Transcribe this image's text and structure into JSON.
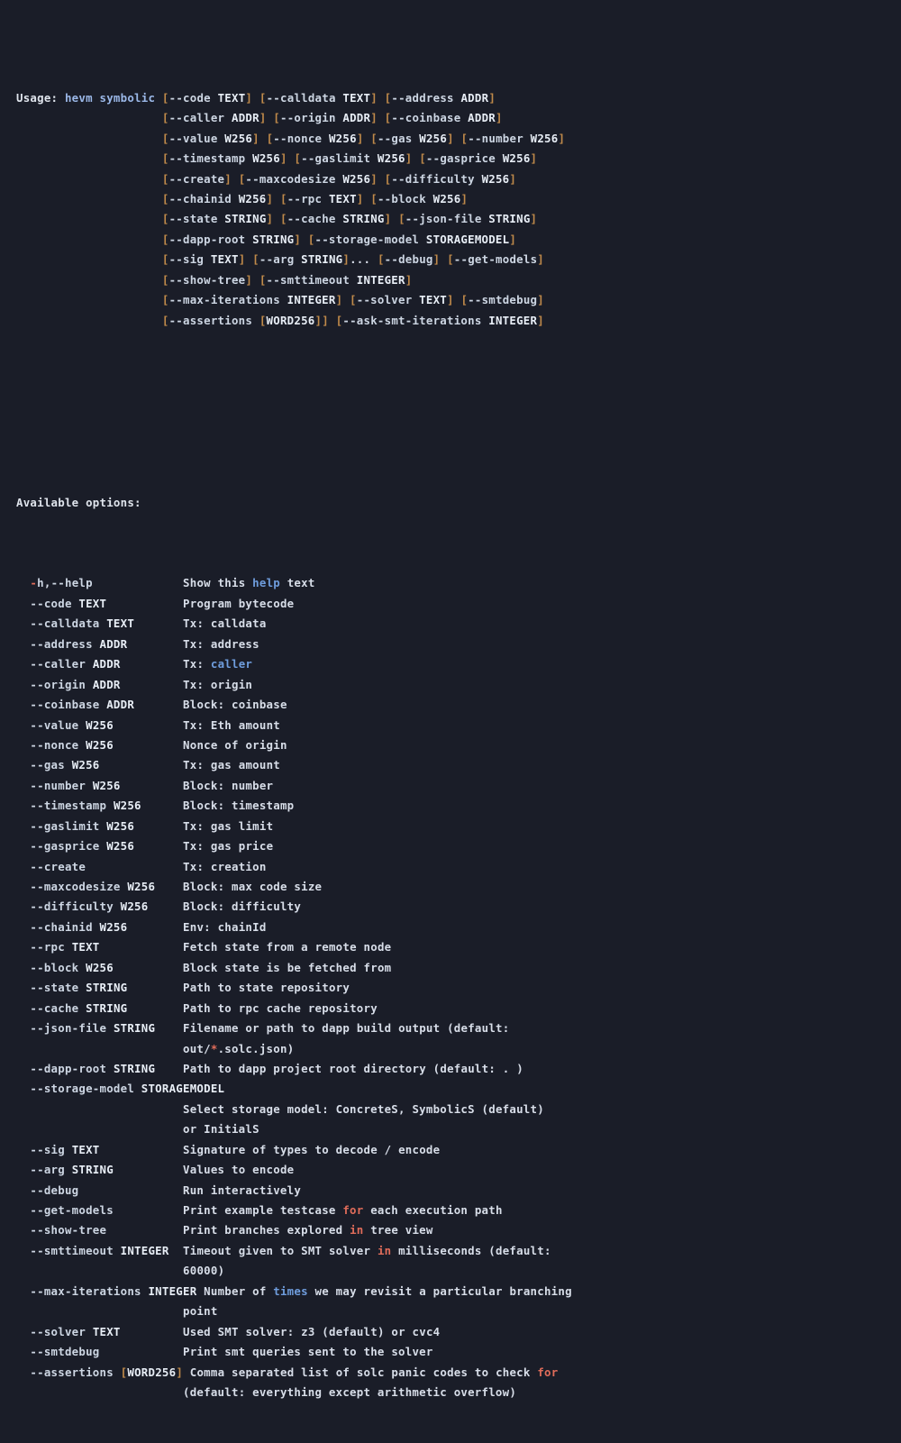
{
  "terminal": {
    "background_color": "#1a1d28",
    "foreground_color": "#d8dee9",
    "accent_bracket_color": "#c08a4a",
    "keyword_color": "#e06c5a",
    "identifier_color": "#6f9ddd",
    "command_color": "#9bb8e8"
  },
  "usage": {
    "label": "Usage:",
    "command": "hevm symbolic",
    "lines": [
      "[--code TEXT] [--calldata TEXT] [--address ADDR]",
      "[--caller ADDR] [--origin ADDR] [--coinbase ADDR]",
      "[--value W256] [--nonce W256] [--gas W256] [--number W256]",
      "[--timestamp W256] [--gaslimit W256] [--gasprice W256]",
      "[--create] [--maxcodesize W256] [--difficulty W256]",
      "[--chainid W256] [--rpc TEXT] [--block W256]",
      "[--state STRING] [--cache STRING] [--json-file STRING]",
      "[--dapp-root STRING] [--storage-model STORAGEMODEL]",
      "[--sig TEXT] [--arg STRING]... [--debug] [--get-models]",
      "[--show-tree] [--smttimeout INTEGER]",
      "[--max-iterations INTEGER] [--solver TEXT] [--smtdebug]",
      "[--assertions [WORD256]] [--ask-smt-iterations INTEGER]"
    ]
  },
  "options_section": {
    "heading": "Available options:",
    "items": [
      {
        "flag": "-h,--help",
        "desc": "Show this help text",
        "cont": []
      },
      {
        "flag": "--code TEXT",
        "desc": "Program bytecode",
        "cont": []
      },
      {
        "flag": "--calldata TEXT",
        "desc": "Tx: calldata",
        "cont": []
      },
      {
        "flag": "--address ADDR",
        "desc": "Tx: address",
        "cont": []
      },
      {
        "flag": "--caller ADDR",
        "desc": "Tx: caller",
        "cont": []
      },
      {
        "flag": "--origin ADDR",
        "desc": "Tx: origin",
        "cont": []
      },
      {
        "flag": "--coinbase ADDR",
        "desc": "Block: coinbase",
        "cont": []
      },
      {
        "flag": "--value W256",
        "desc": "Tx: Eth amount",
        "cont": []
      },
      {
        "flag": "--nonce W256",
        "desc": "Nonce of origin",
        "cont": []
      },
      {
        "flag": "--gas W256",
        "desc": "Tx: gas amount",
        "cont": []
      },
      {
        "flag": "--number W256",
        "desc": "Block: number",
        "cont": []
      },
      {
        "flag": "--timestamp W256",
        "desc": "Block: timestamp",
        "cont": []
      },
      {
        "flag": "--gaslimit W256",
        "desc": "Tx: gas limit",
        "cont": []
      },
      {
        "flag": "--gasprice W256",
        "desc": "Tx: gas price",
        "cont": []
      },
      {
        "flag": "--create",
        "desc": "Tx: creation",
        "cont": []
      },
      {
        "flag": "--maxcodesize W256",
        "desc": "Block: max code size",
        "cont": []
      },
      {
        "flag": "--difficulty W256",
        "desc": "Block: difficulty",
        "cont": []
      },
      {
        "flag": "--chainid W256",
        "desc": "Env: chainId",
        "cont": []
      },
      {
        "flag": "--rpc TEXT",
        "desc": "Fetch state from a remote node",
        "cont": []
      },
      {
        "flag": "--block W256",
        "desc": "Block state is be fetched from",
        "cont": []
      },
      {
        "flag": "--state STRING",
        "desc": "Path to state repository",
        "cont": []
      },
      {
        "flag": "--cache STRING",
        "desc": "Path to rpc cache repository",
        "cont": []
      },
      {
        "flag": "--json-file STRING",
        "desc": "Filename or path to dapp build output (default:",
        "cont": [
          "out/*.solc.json)"
        ]
      },
      {
        "flag": "--dapp-root STRING",
        "desc": "Path to dapp project root directory (default: . )",
        "cont": []
      },
      {
        "flag": "--storage-model STORAGEMODEL",
        "desc": "",
        "cont": [
          "Select storage model: ConcreteS, SymbolicS (default)",
          "or InitialS"
        ]
      },
      {
        "flag": "--sig TEXT",
        "desc": "Signature of types to decode / encode",
        "cont": []
      },
      {
        "flag": "--arg STRING",
        "desc": "Values to encode",
        "cont": []
      },
      {
        "flag": "--debug",
        "desc": "Run interactively",
        "cont": []
      },
      {
        "flag": "--get-models",
        "desc": "Print example testcase for each execution path",
        "cont": []
      },
      {
        "flag": "--show-tree",
        "desc": "Print branches explored in tree view",
        "cont": []
      },
      {
        "flag": "--smttimeout INTEGER",
        "desc": "Timeout given to SMT solver in milliseconds (default:",
        "cont": [
          "60000)"
        ]
      },
      {
        "flag": "--max-iterations INTEGER",
        "desc": "Number of times we may revisit a particular branching",
        "cont": [
          "point"
        ]
      },
      {
        "flag": "--solver TEXT",
        "desc": "Used SMT solver: z3 (default) or cvc4",
        "cont": []
      },
      {
        "flag": "--smtdebug",
        "desc": "Print smt queries sent to the solver",
        "cont": []
      },
      {
        "flag": "--assertions [WORD256]",
        "desc": "Comma separated list of solc panic codes to check for",
        "cont": [
          "(default: everything except arithmetic overflow)"
        ]
      }
    ]
  }
}
